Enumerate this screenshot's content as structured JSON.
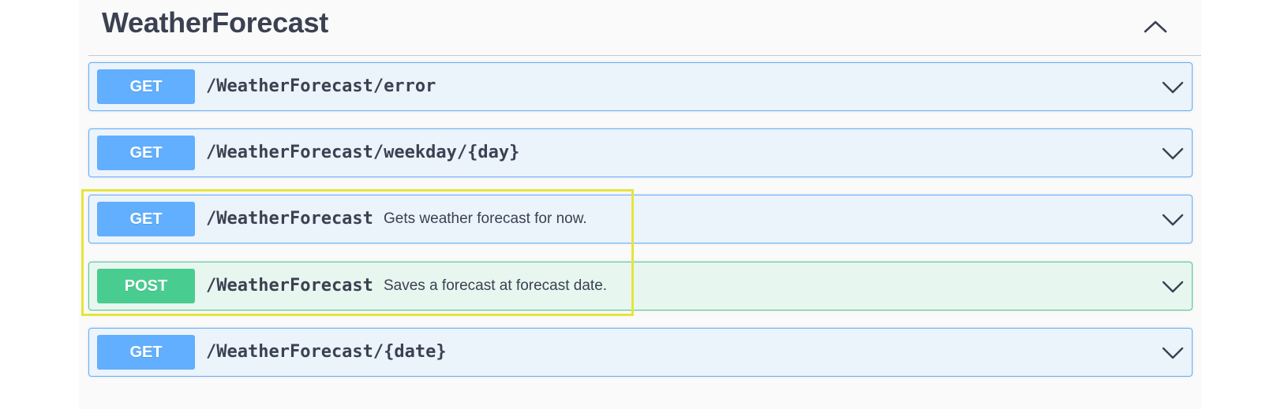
{
  "section": {
    "title": "WeatherForecast",
    "toggle_icon": "chevron-up-icon"
  },
  "operations": [
    {
      "method": "GET",
      "path": "/WeatherForecast/error",
      "summary": "",
      "color": "#61affe",
      "expand_icon": "chevron-down-icon"
    },
    {
      "method": "GET",
      "path": "/WeatherForecast/weekday/{day}",
      "summary": "",
      "color": "#61affe",
      "expand_icon": "chevron-down-icon"
    },
    {
      "method": "GET",
      "path": "/WeatherForecast",
      "summary": "Gets weather forecast for now.",
      "color": "#61affe",
      "expand_icon": "chevron-down-icon"
    },
    {
      "method": "POST",
      "path": "/WeatherForecast",
      "summary": "Saves a forecast at forecast date.",
      "color": "#49cc90",
      "expand_icon": "chevron-down-icon"
    },
    {
      "method": "GET",
      "path": "/WeatherForecast/{date}",
      "summary": "",
      "color": "#61affe",
      "expand_icon": "chevron-down-icon"
    }
  ],
  "colors": {
    "get_accent": "#61affe",
    "post_accent": "#49cc90",
    "highlight_box": "#e6e43b",
    "text": "#3b4151"
  }
}
